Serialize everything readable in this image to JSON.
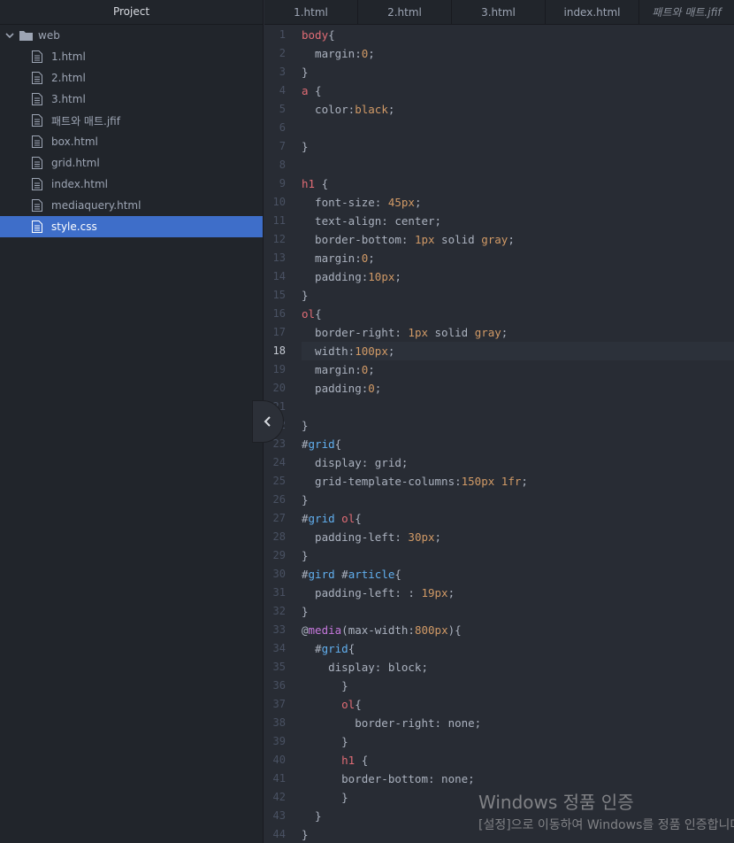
{
  "sidebar": {
    "title": "Project",
    "folder": "web",
    "files": [
      "1.html",
      "2.html",
      "3.html",
      "패트와 매트.jfif",
      "box.html",
      "grid.html",
      "index.html",
      "mediaquery.html",
      "style.css"
    ],
    "selected_index": 8
  },
  "tabs": [
    "1.html",
    "2.html",
    "3.html",
    "index.html",
    "패트와 매트.jfif"
  ],
  "editor": {
    "active_line": 18,
    "lines": [
      [
        [
          "sel",
          "body"
        ],
        [
          "plain",
          "{"
        ]
      ],
      [
        [
          "prop",
          "  margin:"
        ],
        [
          "num",
          "0"
        ],
        [
          "plain",
          ";"
        ]
      ],
      [
        [
          "plain",
          "}"
        ]
      ],
      [
        [
          "sel",
          "a"
        ],
        [
          "plain",
          " {"
        ]
      ],
      [
        [
          "prop",
          "  color:"
        ],
        [
          "num",
          "black"
        ],
        [
          "plain",
          ";"
        ]
      ],
      [],
      [
        [
          "plain",
          "}"
        ]
      ],
      [],
      [
        [
          "sel",
          "h1"
        ],
        [
          "plain",
          " {"
        ]
      ],
      [
        [
          "prop",
          "  font-size: "
        ],
        [
          "num",
          "45px"
        ],
        [
          "plain",
          ";"
        ]
      ],
      [
        [
          "prop",
          "  text-align: center;"
        ]
      ],
      [
        [
          "prop",
          "  border-bottom: "
        ],
        [
          "num",
          "1px"
        ],
        [
          "plain",
          " solid "
        ],
        [
          "num",
          "gray"
        ],
        [
          "plain",
          ";"
        ]
      ],
      [
        [
          "prop",
          "  margin:"
        ],
        [
          "num",
          "0"
        ],
        [
          "plain",
          ";"
        ]
      ],
      [
        [
          "prop",
          "  padding:"
        ],
        [
          "num",
          "10px"
        ],
        [
          "plain",
          ";"
        ]
      ],
      [
        [
          "plain",
          "}"
        ]
      ],
      [
        [
          "sel",
          "ol"
        ],
        [
          "plain",
          "{"
        ]
      ],
      [
        [
          "prop",
          "  border-right: "
        ],
        [
          "num",
          "1px"
        ],
        [
          "plain",
          " solid "
        ],
        [
          "num",
          "gray"
        ],
        [
          "plain",
          ";"
        ]
      ],
      [
        [
          "prop",
          "  width:"
        ],
        [
          "num",
          "100px"
        ],
        [
          "plain",
          ";"
        ]
      ],
      [
        [
          "prop",
          "  margin:"
        ],
        [
          "num",
          "0"
        ],
        [
          "plain",
          ";"
        ]
      ],
      [
        [
          "prop",
          "  padding:"
        ],
        [
          "num",
          "0"
        ],
        [
          "plain",
          ";"
        ]
      ],
      [],
      [
        [
          "plain",
          "}"
        ]
      ],
      [
        [
          "plain",
          "#"
        ],
        [
          "id",
          "grid"
        ],
        [
          "plain",
          "{"
        ]
      ],
      [
        [
          "prop",
          "  display: grid;"
        ]
      ],
      [
        [
          "prop",
          "  grid-template-columns:"
        ],
        [
          "num",
          "150px"
        ],
        [
          "plain",
          " "
        ],
        [
          "num",
          "1fr"
        ],
        [
          "plain",
          ";"
        ]
      ],
      [
        [
          "plain",
          "}"
        ]
      ],
      [
        [
          "plain",
          "#"
        ],
        [
          "id",
          "grid"
        ],
        [
          "plain",
          " "
        ],
        [
          "sel",
          "ol"
        ],
        [
          "plain",
          "{"
        ]
      ],
      [
        [
          "prop",
          "  padding-left: "
        ],
        [
          "num",
          "30px"
        ],
        [
          "plain",
          ";"
        ]
      ],
      [
        [
          "plain",
          "}"
        ]
      ],
      [
        [
          "plain",
          "#"
        ],
        [
          "id",
          "gird"
        ],
        [
          "plain",
          " #"
        ],
        [
          "id",
          "article"
        ],
        [
          "plain",
          "{"
        ]
      ],
      [
        [
          "prop",
          "  padding-left: : "
        ],
        [
          "num",
          "19px"
        ],
        [
          "plain",
          ";"
        ]
      ],
      [
        [
          "plain",
          "}"
        ]
      ],
      [
        [
          "plain",
          "@"
        ],
        [
          "kw",
          "media"
        ],
        [
          "plain",
          "(max-width:"
        ],
        [
          "num",
          "800px"
        ],
        [
          "plain",
          "){"
        ]
      ],
      [
        [
          "plain",
          "  #"
        ],
        [
          "id",
          "grid"
        ],
        [
          "plain",
          "{"
        ]
      ],
      [
        [
          "prop",
          "    display: block;"
        ]
      ],
      [
        [
          "plain",
          "      }"
        ]
      ],
      [
        [
          "plain",
          "      "
        ],
        [
          "sel",
          "ol"
        ],
        [
          "plain",
          "{"
        ]
      ],
      [
        [
          "prop",
          "        border-right: none;"
        ]
      ],
      [
        [
          "plain",
          "      }"
        ]
      ],
      [
        [
          "plain",
          "      "
        ],
        [
          "sel",
          "h1"
        ],
        [
          "plain",
          " {"
        ]
      ],
      [
        [
          "prop",
          "      border-bottom: none;"
        ]
      ],
      [
        [
          "plain",
          "      }"
        ]
      ],
      [
        [
          "plain",
          "  }"
        ]
      ],
      [
        [
          "plain",
          "}"
        ]
      ]
    ]
  },
  "watermark": {
    "title": "Windows 정품 인증",
    "subtitle": "[설정]으로 이동하여 Windows를 정품 인증합니다."
  },
  "icons": {
    "folder": "folder-icon",
    "file": "file-icon",
    "collapse": "chevron-left-icon"
  }
}
